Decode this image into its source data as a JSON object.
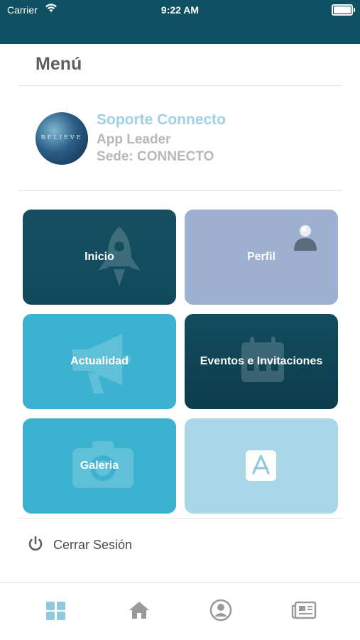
{
  "status_bar": {
    "carrier": "Carrier",
    "time": "9:22 AM"
  },
  "menu": {
    "title": "Menú"
  },
  "profile": {
    "avatar_text": "BELIEVE",
    "name": "Soporte Connecto",
    "role": "App Leader",
    "sede": "Sede: CONNECTO"
  },
  "tiles": [
    {
      "label": "Inicio",
      "icon": "rocket-icon"
    },
    {
      "label": "Perfil",
      "icon": "person-icon"
    },
    {
      "label": "Actualidad",
      "icon": "megaphone-icon"
    },
    {
      "label": "Eventos e Invitaciones",
      "icon": "calendar-icon"
    },
    {
      "label": "Galeria",
      "icon": "camera-icon"
    },
    {
      "label": "",
      "icon": "app-store-icon"
    }
  ],
  "logout": {
    "label": "Cerrar Sesión",
    "icon": "power-icon"
  },
  "tabbar": {
    "items": [
      {
        "icon": "grid-icon",
        "active": true
      },
      {
        "icon": "home-icon",
        "active": false
      },
      {
        "icon": "user-circle-icon",
        "active": false
      },
      {
        "icon": "newspaper-icon",
        "active": false
      }
    ]
  },
  "colors": {
    "status_bar": "#0f5163",
    "accent_active": "#8fc9dd",
    "tile_dark": "#0f4a5c",
    "tile_periwinkle": "#9eb0cf",
    "tile_cyan": "#3db2d0",
    "tile_light": "#a9d7e8"
  }
}
